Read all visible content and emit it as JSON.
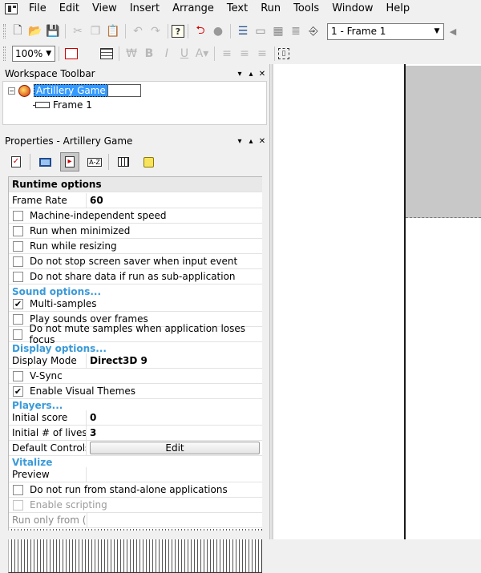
{
  "menu": {
    "items": [
      "File",
      "Edit",
      "View",
      "Insert",
      "Arrange",
      "Text",
      "Run",
      "Tools",
      "Window",
      "Help"
    ]
  },
  "toolbar": {
    "frame_select_value": "1 - Frame 1",
    "zoom_value": "100%",
    "bold_label": "B",
    "italic_label": "I",
    "underline_label": "U"
  },
  "workspace": {
    "title": "Workspace Toolbar",
    "root_label": "Artillery Game",
    "child_label": "Frame 1"
  },
  "properties": {
    "title": "Properties - Artillery Game",
    "tabs": [
      "checklist-icon",
      "monitor-icon",
      "runtime-icon",
      "sort-az-icon",
      "grid-icon",
      "note-icon"
    ],
    "runtime_header": "Runtime options",
    "frame_rate_label": "Frame Rate",
    "frame_rate_value": "60",
    "opt_machine_independent": "Machine-independent speed",
    "opt_run_minimized": "Run when minimized",
    "opt_run_resizing": "Run while resizing",
    "opt_no_stop_screensaver": "Do not stop screen saver when input event",
    "opt_no_share_data": "Do not share data if run as sub-application",
    "sound_section": "Sound options...",
    "opt_multi_samples": "Multi-samples",
    "opt_play_sounds": "Play sounds over frames",
    "opt_no_mute": "Do not mute samples when application loses focus",
    "display_section": "Display options...",
    "display_mode_label": "Display Mode",
    "display_mode_value": "Direct3D 9",
    "opt_vsync": "V-Sync",
    "opt_visual_themes": "Enable Visual Themes",
    "players_section": "Players...",
    "initial_score_label": "Initial score",
    "initial_score_value": "0",
    "initial_lives_label": "Initial # of lives",
    "initial_lives_value": "3",
    "default_controls_label": "Default Controls",
    "edit_button_label": "Edit",
    "vitalize_section": "Vitalize",
    "preview_label": "Preview",
    "opt_no_standalone": "Do not run from stand-alone applications",
    "opt_enable_scripting": "Enable scripting",
    "run_only_from_label": "Run only from (U"
  },
  "checkbox_states": {
    "machine_independent": false,
    "run_minimized": false,
    "run_resizing": false,
    "no_stop_screensaver": false,
    "no_share_data": false,
    "multi_samples": true,
    "play_sounds": false,
    "no_mute": false,
    "vsync": false,
    "visual_themes": true,
    "no_standalone": false,
    "enable_scripting": false
  },
  "colors": {
    "section_text": "#3a9ad8",
    "selection_bg": "#3399ff"
  }
}
